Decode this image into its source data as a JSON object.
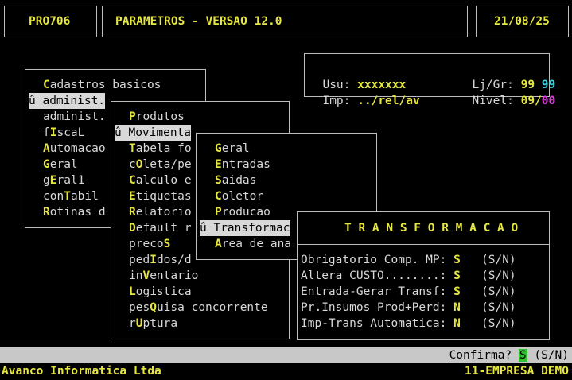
{
  "header": {
    "program": "PRO706",
    "title": "PARAMETROS - VERSAO 12.0",
    "date": "21/08/25"
  },
  "info": {
    "usu_label": "Usu:",
    "usu_value": "xxxxxxx",
    "lj_label": "Lj/Gr:",
    "lj_value": "99",
    "gr_value": "99",
    "imp_label": "Imp:",
    "imp_value": "../rel/av",
    "nivel_label": "Nivel:",
    "nivel_value": "09",
    "nivel_sep": "/",
    "nivel_value2": "00"
  },
  "menu1": {
    "items": [
      {
        "pre": "",
        "hk": "C",
        "post": "adastros basicos"
      },
      {
        "pre": "û administ.",
        "hk": "",
        "post": ""
      },
      {
        "pre": "administ.",
        "hk": "",
        "post": ""
      },
      {
        "pre": "f",
        "hk": "I",
        "post": "scaL"
      },
      {
        "pre": "",
        "hk": "A",
        "post": "utomacao"
      },
      {
        "pre": "",
        "hk": "G",
        "post": "eral"
      },
      {
        "pre": "g",
        "hk": "E",
        "post": "ral1"
      },
      {
        "pre": "con",
        "hk": "T",
        "post": "abil"
      },
      {
        "pre": "",
        "hk": "R",
        "post": "otinas d"
      }
    ]
  },
  "menu2": {
    "items": [
      {
        "pre": "",
        "hk": "P",
        "post": "rodutos"
      },
      {
        "pre": "û Movimenta",
        "hk": "",
        "post": ""
      },
      {
        "pre": "",
        "hk": "T",
        "post": "abela fo"
      },
      {
        "pre": "c",
        "hk": "O",
        "post": "leta/pe"
      },
      {
        "pre": "",
        "hk": "C",
        "post": "alculo e"
      },
      {
        "pre": "",
        "hk": "E",
        "post": "tiquetas"
      },
      {
        "pre": "",
        "hk": "R",
        "post": "elatorio"
      },
      {
        "pre": "",
        "hk": "D",
        "post": "efault r"
      },
      {
        "pre": "preco",
        "hk": "S",
        "post": ""
      },
      {
        "pre": "ped",
        "hk": "I",
        "post": "dos/d"
      },
      {
        "pre": "in",
        "hk": "V",
        "post": "entario"
      },
      {
        "pre": "",
        "hk": "L",
        "post": "ogistica"
      },
      {
        "pre": "pes",
        "hk": "Q",
        "post": "uisa concorrente"
      },
      {
        "pre": "r",
        "hk": "U",
        "post": "ptura"
      }
    ]
  },
  "menu3": {
    "items": [
      {
        "pre": "",
        "hk": "G",
        "post": "eral"
      },
      {
        "pre": "",
        "hk": "E",
        "post": "ntradas"
      },
      {
        "pre": "",
        "hk": "S",
        "post": "aidas"
      },
      {
        "pre": "",
        "hk": "C",
        "post": "oletor"
      },
      {
        "pre": "",
        "hk": "P",
        "post": "roducao"
      },
      {
        "pre": "û Transformac",
        "hk": "",
        "post": ""
      },
      {
        "pre": "",
        "hk": "A",
        "post": "rea de ana"
      }
    ]
  },
  "transf": {
    "title": "T R A N S F O R M A C A O",
    "rows": [
      {
        "label": "Obrigatorio Comp. MP:",
        "value": "S",
        "opts": "(S/N)"
      },
      {
        "label": "Altera CUSTO........:",
        "value": "S",
        "opts": "(S/N)"
      },
      {
        "label": "Entrada-Gerar Transf:",
        "value": "S",
        "opts": "(S/N)"
      },
      {
        "label": "Pr.Insumos Prod+Perd:",
        "value": "N",
        "opts": "(S/N)"
      },
      {
        "label": "Imp-Trans Automatica:",
        "value": "N",
        "opts": "(S/N)"
      }
    ]
  },
  "status": {
    "prompt": "Confirma?",
    "answer": "S",
    "opts": "(S/N)"
  },
  "footer": {
    "left": "Avanco Informatica Ltda",
    "right": "11-EMPRESA DEMO"
  }
}
